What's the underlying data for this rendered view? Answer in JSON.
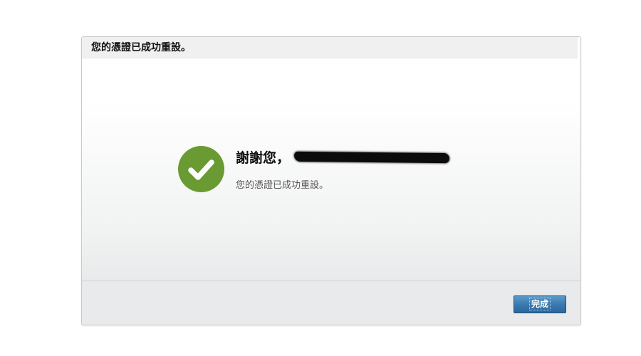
{
  "dialog": {
    "title": "您的憑證已成功重設。",
    "thanks_prefix": "謝謝您，",
    "message": "您的憑證已成功重設。",
    "icon": "checkmark-circle-icon",
    "done_label": "完成"
  },
  "colors": {
    "success_green": "#6a9a32",
    "button_blue": "#2f6fa6",
    "header_bg": "#f0f0f0"
  }
}
